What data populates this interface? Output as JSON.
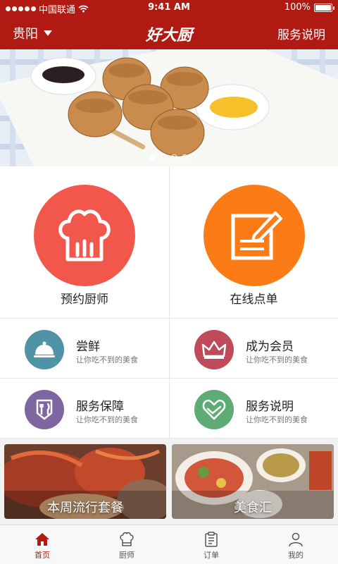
{
  "status_bar": {
    "carrier": "中国联通",
    "time": "9:41 AM",
    "battery": "100%"
  },
  "nav": {
    "city": "贵阳",
    "title": "好大厨",
    "right_link": "服务说明"
  },
  "banner": {
    "page_count": 4,
    "active_index": 0
  },
  "primary_actions": [
    {
      "label": "预约厨师",
      "icon": "chef-hat-icon",
      "color": "#f2574b"
    },
    {
      "label": "在线点单",
      "icon": "order-edit-icon",
      "color": "#fb7c17"
    }
  ],
  "features": [
    {
      "title": "尝鲜",
      "subtitle": "让你吃不到的美食",
      "icon": "cloche-icon",
      "color": "#4f93a6"
    },
    {
      "title": "成为会员",
      "subtitle": "让你吃不到的美食",
      "icon": "crown-icon",
      "color": "#bf4b5a"
    },
    {
      "title": "服务保障",
      "subtitle": "让你吃不到的美食",
      "icon": "cutlery-icon",
      "color": "#7e66a1"
    },
    {
      "title": "服务说明",
      "subtitle": "让你吃不到的美食",
      "icon": "heart-icon",
      "color": "#5fab75"
    }
  ],
  "promo_cards": [
    {
      "label": "本周流行套餐"
    },
    {
      "label": "美食汇"
    }
  ],
  "tabbar": {
    "active": "home",
    "items": [
      {
        "label": "首页",
        "icon": "home-icon"
      },
      {
        "label": "厨师",
        "icon": "chef-hat-icon"
      },
      {
        "label": "订单",
        "icon": "clipboard-icon"
      },
      {
        "label": "我的",
        "icon": "user-icon"
      }
    ]
  },
  "colors": {
    "brand": "#b01a12"
  }
}
